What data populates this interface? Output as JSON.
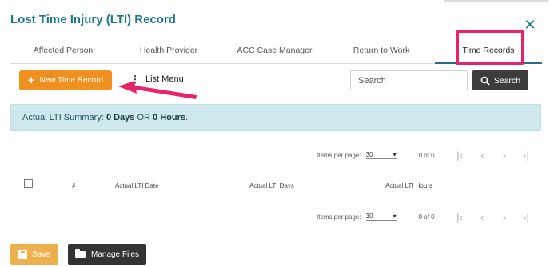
{
  "dialog": {
    "title": "Lost Time Injury (LTI) Record",
    "close_glyph": "✕"
  },
  "tabs": [
    {
      "label": "Affected Person",
      "active": false
    },
    {
      "label": "Health Provider",
      "active": false
    },
    {
      "label": "ACC Case Manager",
      "active": false
    },
    {
      "label": "Return to Work",
      "active": false
    },
    {
      "label": "Time Records",
      "active": true
    }
  ],
  "toolbar": {
    "new_label": "New Time Record",
    "list_menu_label": "List Menu",
    "search_placeholder": "Search",
    "search_value": "",
    "search_button_label": "Search"
  },
  "summary": {
    "prefix": "Actual LTI Summary: ",
    "days": "0 Days",
    "or": " OR ",
    "hours": "0 Hours",
    "suffix": "."
  },
  "pager": {
    "items_per_page_label": "Items per page:",
    "items_per_page": "30",
    "range": "0 of 0",
    "first_glyph": "|‹",
    "prev_glyph": "‹",
    "next_glyph": "›",
    "last_glyph": "›|"
  },
  "table": {
    "columns": [
      "#",
      "Actual LTI Date",
      "Actual LTI Days",
      "Actual LTI Hours"
    ],
    "rows": []
  },
  "footer": {
    "save_label": "Save",
    "manage_files_label": "Manage Files"
  },
  "colors": {
    "title": "#1a7a8c",
    "primary": "#f0901f",
    "save": "#eeb04c",
    "dark": "#3c3c3c",
    "summary_bg": "#cfe8ec",
    "highlight": "#e8236c"
  }
}
